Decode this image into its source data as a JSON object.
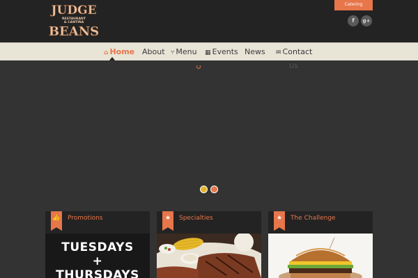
{
  "header": {
    "logo": {
      "line1": "JUDGE",
      "line2": "RESTAURANT",
      "line3": "& CANTINA",
      "line4": "BEANS"
    },
    "catering_label": "Catering",
    "social": [
      {
        "icon": "facebook-icon",
        "glyph": "f"
      },
      {
        "icon": "google-plus-icon",
        "glyph": "g+"
      }
    ]
  },
  "nav": {
    "items": [
      {
        "label": "Home",
        "icon": "home-icon",
        "active": true
      },
      {
        "label": "About",
        "icon": "",
        "active": false
      },
      {
        "label": "Menu",
        "icon": "utensils-icon",
        "active": false
      },
      {
        "label": "Events",
        "icon": "calendar-icon",
        "active": false
      },
      {
        "label": "News",
        "icon": "",
        "active": false
      },
      {
        "label": "Contact",
        "icon": "envelope-icon",
        "active": false
      }
    ],
    "overflow_text": "Us"
  },
  "slider": {
    "dots": [
      {
        "color": "#e4b32b",
        "active": true
      },
      {
        "color": "#e7764a",
        "active": false
      }
    ]
  },
  "cards": [
    {
      "title": "Promotions",
      "icon": "thumbs-up-icon",
      "body_lines": [
        "TUESDAYS",
        "+",
        "THURSDAYS"
      ]
    },
    {
      "title": "Specialties",
      "icon": "star-icon",
      "image": "steak-corn-plate"
    },
    {
      "title": "The Challenge",
      "icon": "star-icon",
      "image": "burger"
    }
  ],
  "colors": {
    "accent": "#e7764a",
    "header_bg": "#232323",
    "nav_bg": "#e8e4d6",
    "page_bg": "#333333"
  }
}
